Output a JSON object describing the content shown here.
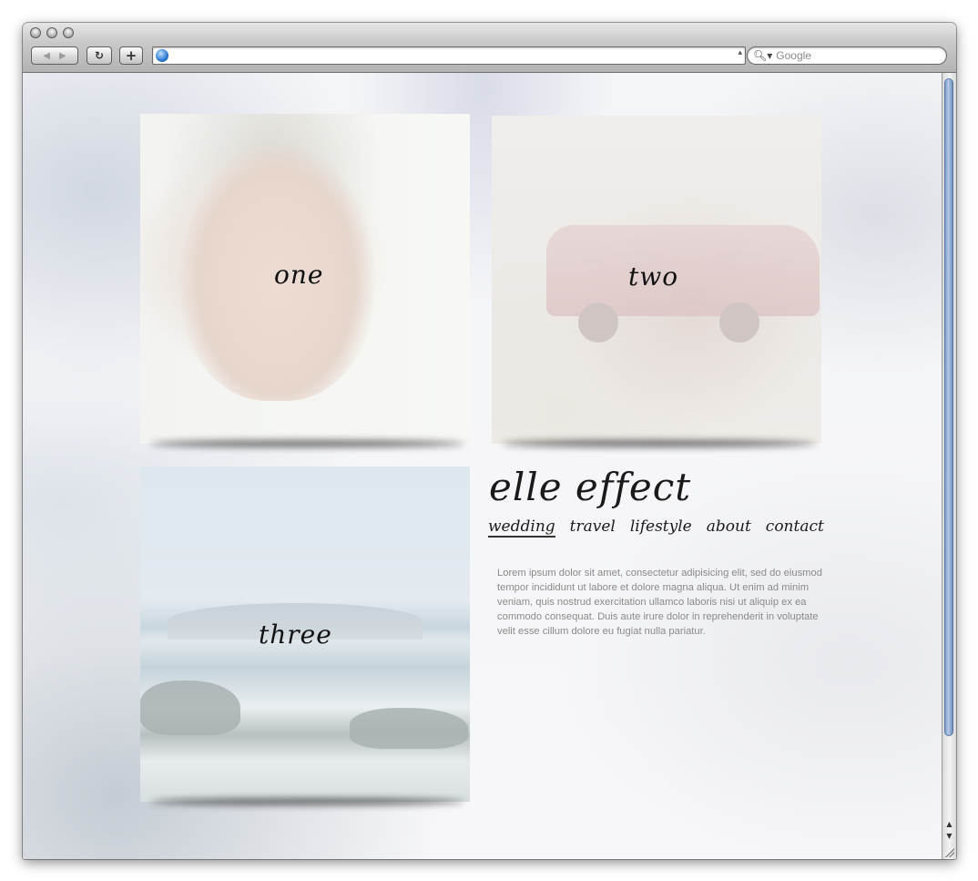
{
  "browser": {
    "search_placeholder": "Google",
    "url": ""
  },
  "tiles": [
    {
      "label": "one"
    },
    {
      "label": "two"
    },
    {
      "label": "three"
    }
  ],
  "site": {
    "brand": "elle effect",
    "nav": [
      "wedding",
      "travel",
      "lifestyle",
      "about",
      "contact"
    ],
    "active_nav": "wedding",
    "intro": "Lorem ipsum dolor sit amet, consectetur adipisicing elit, sed do eiusmod tempor incididunt ut labore et dolore magna aliqua. Ut enim ad minim veniam, quis nostrud exercitation ullamco laboris nisi ut aliquip ex ea commodo consequat. Duis aute irure dolor in reprehenderit in voluptate velit esse cillum dolore eu fugiat nulla pariatur."
  },
  "icons": {
    "back": "back-arrow-icon",
    "forward": "forward-arrow-icon",
    "reload": "reload-icon",
    "add": "add-bookmark-icon",
    "globe": "globe-icon",
    "search": "search-icon"
  }
}
